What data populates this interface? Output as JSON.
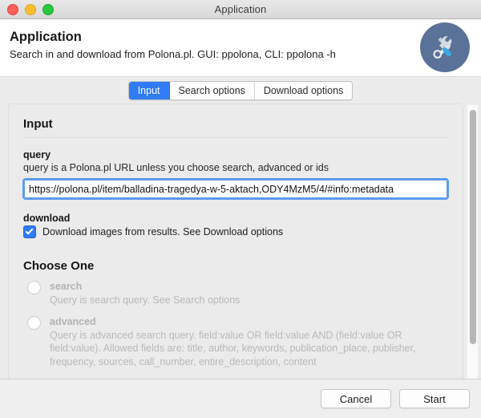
{
  "window": {
    "title": "Application",
    "controls": {
      "close": "close-window",
      "minimize": "minimize-window",
      "maximize": "maximize-window"
    }
  },
  "header": {
    "title": "Application",
    "subtitle": "Search in and download from Polona.pl. GUI: ppolona, CLI: ppolona -h",
    "icon": "tools-icon",
    "icon_color": "#5a7298"
  },
  "tabs": [
    {
      "label": "Input",
      "active": true
    },
    {
      "label": "Search options",
      "active": false
    },
    {
      "label": "Download options",
      "active": false
    }
  ],
  "main": {
    "section_title": "Input",
    "query": {
      "label": "query",
      "hint": "query is a Polona.pl URL unless you choose search, advanced or ids",
      "value": "https://polona.pl/item/balladina-tragedya-w-5-aktach,ODY4MzM5/4/#info:metadata",
      "placeholder": ""
    },
    "download": {
      "label": "download",
      "checkbox_label": "Download images from results. See Download options",
      "checked": true
    },
    "choose_one": {
      "title": "Choose One",
      "options": [
        {
          "label": "search",
          "description": "Query is search query. See Search options",
          "selected": false
        },
        {
          "label": "advanced",
          "description": "Query is advanced search query. field:value OR field:value AND (field:value OR field:value). Allowed fields are: title, author, keywords, publication_place, publisher, frequency, sources, call_number, entire_description, content",
          "selected": false
        }
      ]
    }
  },
  "footer": {
    "cancel_label": "Cancel",
    "start_label": "Start"
  },
  "colors": {
    "accent": "#2f7cf6",
    "focus_ring": "#5a9bf0",
    "icon_badge": "#5a7298"
  }
}
